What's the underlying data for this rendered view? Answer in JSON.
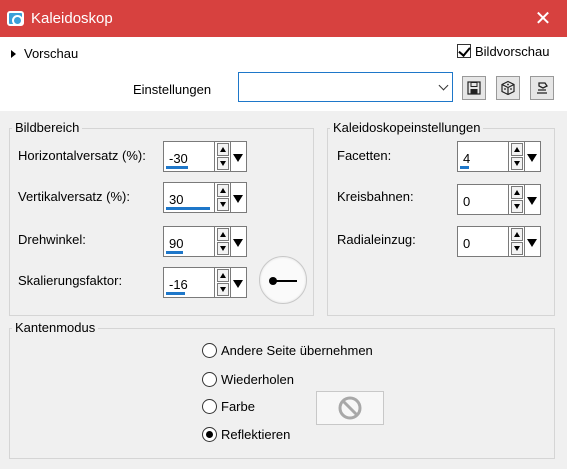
{
  "window": {
    "title": "Kaleidoskop",
    "close_glyph": "✕"
  },
  "toolbar": {
    "preview_label": "Vorschau",
    "bild_preview_label": "Bildvorschau",
    "bild_preview_checked": true,
    "presets_label": "Einstellungen",
    "presets_value": ""
  },
  "bildbereich": {
    "title": "Bildbereich",
    "fields": [
      {
        "label": "Horizontalversatz (%):",
        "value": "-30",
        "level": 0.48
      },
      {
        "label": "Vertikalversatz (%):",
        "value": "30",
        "level": 0.95
      },
      {
        "label": "Drehwinkel:",
        "value": "90",
        "level": 0.36
      },
      {
        "label": "Skalierungsfaktor:",
        "value": "-16",
        "level": 0.42
      }
    ]
  },
  "kaleido": {
    "title": "Kaleidoskopeinstellungen",
    "fields": [
      {
        "label": "Facetten:",
        "value": "4",
        "level": 0.2
      },
      {
        "label": "Kreisbahnen:",
        "value": "0",
        "level": 0
      },
      {
        "label": "Radialeinzug:",
        "value": "0",
        "level": 0
      }
    ]
  },
  "kantenmodus": {
    "title": "Kantenmodus",
    "options": [
      "Andere Seite übernehmen",
      "Wiederholen",
      "Farbe",
      "Reflektieren"
    ],
    "selected": "Reflektieren"
  },
  "icons": {
    "app": "kaleidoscope-app-icon",
    "save": "save-preset-icon",
    "reset": "reset-defaults-cube-icon",
    "randomize": "randomize-icon",
    "color_disabled": "no-color-icon"
  }
}
